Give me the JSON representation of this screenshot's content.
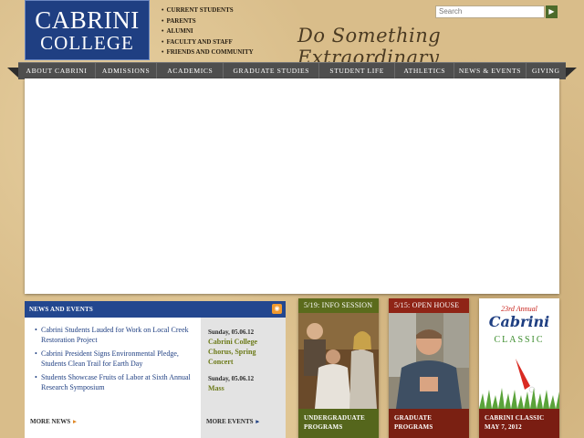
{
  "logo": {
    "line1": "CABRINI",
    "line2": "COLLEGE"
  },
  "quick_links": [
    "CURRENT STUDENTS",
    "PARENTS",
    "ALUMNI",
    "FACULTY AND STAFF",
    "FRIENDS AND COMMUNITY"
  ],
  "search": {
    "placeholder": "Search",
    "button_icon": "arrow-right-icon"
  },
  "tagline": "Do Something Extraordinary",
  "nav": [
    "ABOUT CABRINI",
    "ADMISSIONS",
    "ACADEMICS",
    "GRADUATE STUDIES",
    "STUDENT LIFE",
    "ATHLETICS",
    "NEWS & EVENTS",
    "GIVING"
  ],
  "news": {
    "title": "NEWS AND EVENTS",
    "items": [
      "Cabrini Students Lauded for Work on Local Creek Restoration Project",
      "Cabrini President Signs Environmental Pledge, Students Clean Trail for Earth Day",
      "Students Showcase Fruits of Labor at Sixth Annual Research Symposium"
    ],
    "more_news": "MORE NEWS",
    "events": [
      {
        "date": "Sunday, 05.06.12",
        "title": "Cabrini College Chorus, Spring Concert"
      },
      {
        "date": "Sunday, 05.06.12",
        "title": "Mass"
      }
    ],
    "more_events": "MORE EVENTS"
  },
  "promos": [
    {
      "header": "5/19: INFO SESSION",
      "footer": "UNDERGRADUATE PROGRAMS"
    },
    {
      "header": "5/15: OPEN HOUSE",
      "footer": "GRADUATE PROGRAMS"
    },
    {
      "top": "23rd Annual",
      "name": "Cabrini",
      "word": "CLASSIC",
      "footer": "CABRINI CLASSIC MAY 7, 2012"
    }
  ],
  "colors": {
    "navy": "#1f3f82",
    "nav_bar": "#4e4e4e",
    "olive": "#5b6b1c",
    "maroon": "#7a1d12",
    "event_green": "#6c7a18"
  }
}
